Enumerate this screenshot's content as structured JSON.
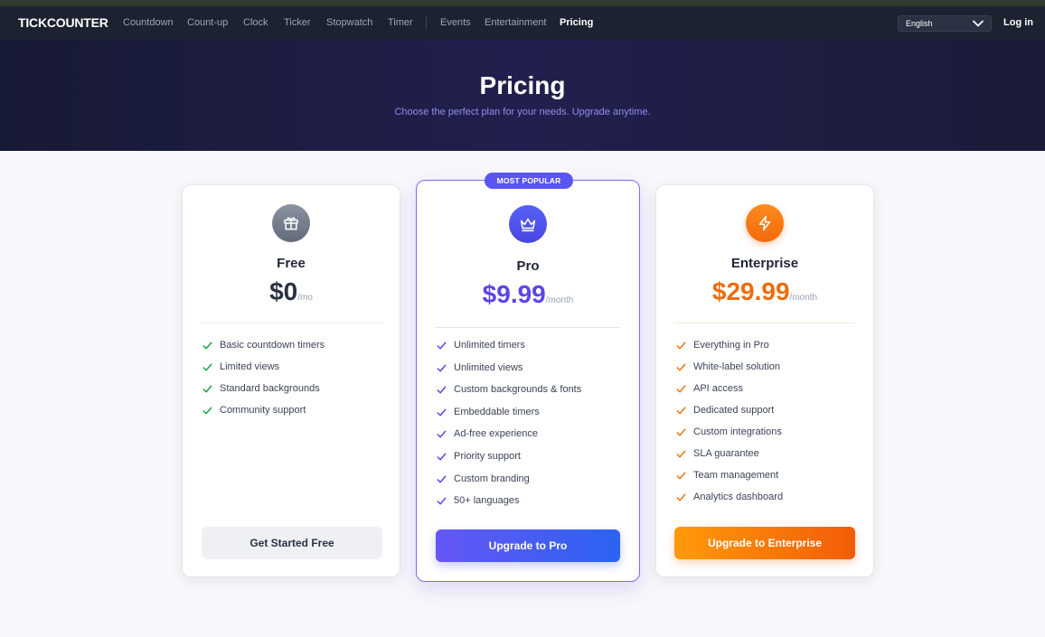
{
  "nav": {
    "brand": "TICKCOUNTER",
    "links": [
      "Countdown",
      "Count-up",
      "Clock",
      "Ticker",
      "Stopwatch",
      "Timer",
      "Events",
      "Entertainment",
      "Pricing"
    ],
    "active": "Pricing",
    "language": "English",
    "login": "Log in"
  },
  "hero": {
    "title": "Pricing",
    "subtitle": "Choose the perfect plan for your needs. Upgrade anytime."
  },
  "plans": [
    {
      "name": "Free",
      "price": "$0",
      "period": "/mo",
      "icon": "gift-icon",
      "features": [
        "Basic countdown timers",
        "Limited views",
        "Standard backgrounds",
        "Community support"
      ],
      "cta": "Get Started Free",
      "accent": "#16a34a"
    },
    {
      "name": "Pro",
      "badge": "MOST POPULAR",
      "price": "$9.99",
      "period": "/month",
      "icon": "crown-icon",
      "features": [
        "Unlimited timers",
        "Unlimited views",
        "Custom backgrounds & fonts",
        "Embeddable timers",
        "Ad-free experience",
        "Priority support",
        "Custom branding",
        "50+ languages"
      ],
      "cta": "Upgrade to Pro",
      "accent": "#5a45e6"
    },
    {
      "name": "Enterprise",
      "price": "$29.99",
      "period": "/month",
      "icon": "lightning-icon",
      "features": [
        "Everything in Pro",
        "White-label solution",
        "API access",
        "Dedicated support",
        "Custom integrations",
        "SLA guarantee",
        "Team management",
        "Analytics dashboard"
      ],
      "cta": "Upgrade to Enterprise",
      "accent": "#e8740f"
    }
  ]
}
